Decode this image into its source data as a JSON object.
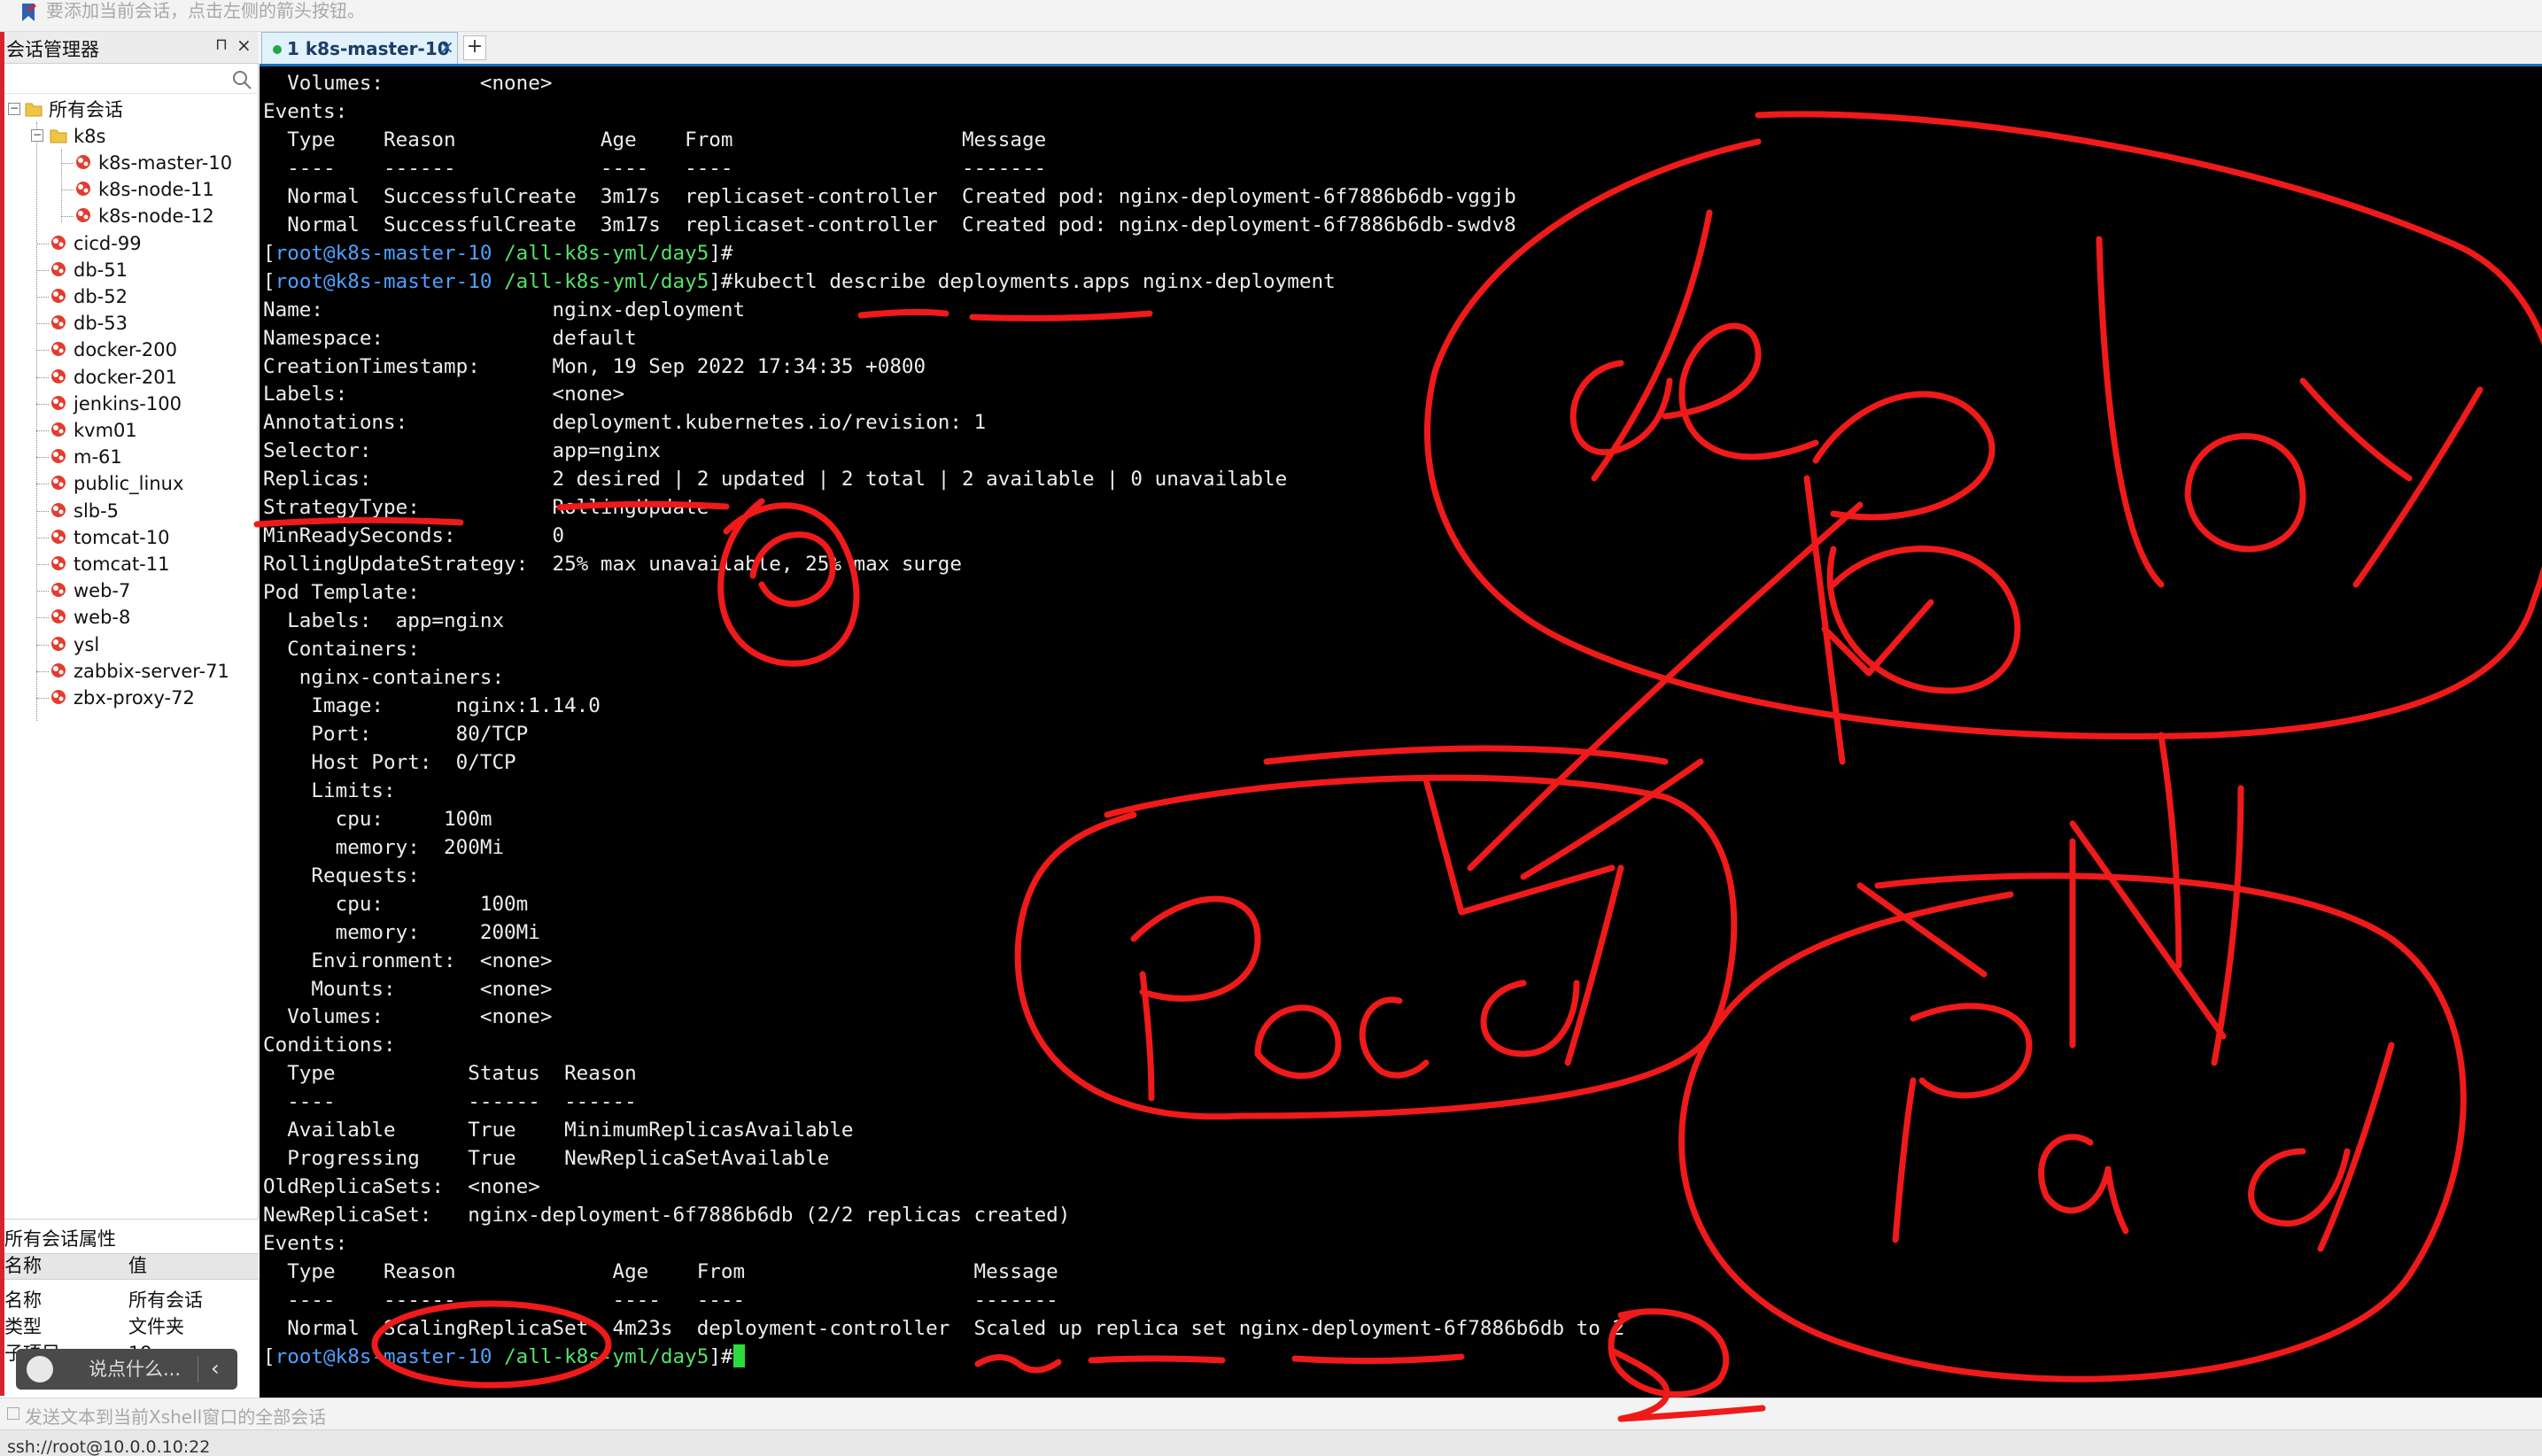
{
  "notice": {
    "text": "要添加当前会话，点击左侧的箭头按钮。"
  },
  "session_manager": {
    "title": "会话管理器",
    "root": "所有会话",
    "group": "k8s",
    "group_children": [
      "k8s-master-10",
      "k8s-node-11",
      "k8s-node-12"
    ],
    "sessions": [
      "cicd-99",
      "db-51",
      "db-52",
      "db-53",
      "docker-200",
      "docker-201",
      "jenkins-100",
      "kvm01",
      "m-61",
      "public_linux",
      "slb-5",
      "tomcat-10",
      "tomcat-11",
      "web-7",
      "web-8",
      "ysl",
      "zabbix-server-71",
      "zbx-proxy-72"
    ]
  },
  "properties": {
    "title": "所有会话属性",
    "col_name": "名称",
    "col_value": "值",
    "rows": [
      {
        "name": "名称",
        "value": "所有会话"
      },
      {
        "name": "类型",
        "value": "文件夹"
      },
      {
        "name": "子项目",
        "value": "19"
      }
    ]
  },
  "chat": {
    "placeholder": "说点什么..."
  },
  "tab": {
    "label": "1 k8s-master-10",
    "close": "×",
    "add": "+"
  },
  "terminal": {
    "prompt_user": "root@k8s-master-10",
    "prompt_path": "/all-k8s-yml/day5",
    "command": "kubectl describe deployments.apps nginx-deployment",
    "lines_before": [
      "  Volumes:        <none>",
      "Events:",
      "  Type    Reason            Age    From                   Message",
      "  ----    ------            ----   ----                   -------",
      "  Normal  SuccessfulCreate  3m17s  replicaset-controller  Created pod: nginx-deployment-6f7886b6db-vggjb",
      "  Normal  SuccessfulCreate  3m17s  replicaset-controller  Created pod: nginx-deployment-6f7886b6db-swdv8"
    ],
    "lines_output": [
      "Name:                   nginx-deployment",
      "Namespace:              default",
      "CreationTimestamp:      Mon, 19 Sep 2022 17:34:35 +0800",
      "Labels:                 <none>",
      "Annotations:            deployment.kubernetes.io/revision: 1",
      "Selector:               app=nginx",
      "Replicas:               2 desired | 2 updated | 2 total | 2 available | 0 unavailable",
      "StrategyType:           RollingUpdate",
      "MinReadySeconds:        0",
      "RollingUpdateStrategy:  25% max unavailable, 25% max surge",
      "Pod Template:",
      "  Labels:  app=nginx",
      "  Containers:",
      "   nginx-containers:",
      "    Image:      nginx:1.14.0",
      "    Port:       80/TCP",
      "    Host Port:  0/TCP",
      "    Limits:",
      "      cpu:     100m",
      "      memory:  200Mi",
      "    Requests:",
      "      cpu:        100m",
      "      memory:     200Mi",
      "    Environment:  <none>",
      "    Mounts:       <none>",
      "  Volumes:        <none>",
      "Conditions:",
      "  Type           Status  Reason",
      "  ----           ------  ------",
      "  Available      True    MinimumReplicasAvailable",
      "  Progressing    True    NewReplicaSetAvailable",
      "OldReplicaSets:  <none>",
      "NewReplicaSet:   nginx-deployment-6f7886b6db (2/2 replicas created)",
      "Events:",
      "  Type    Reason             Age    From                   Message",
      "  ----    ------             ----   ----                   -------",
      "  Normal  ScalingReplicaSet  4m23s  deployment-controller  Scaled up replica set nginx-deployment-6f7886b6db to 2"
    ]
  },
  "sendbar": {
    "text": "发送文本到当前Xshell窗口的全部会话"
  },
  "statusbar": {
    "text": "ssh://root@10.0.0.10:22"
  },
  "annotation_color": "#ef1a1a"
}
